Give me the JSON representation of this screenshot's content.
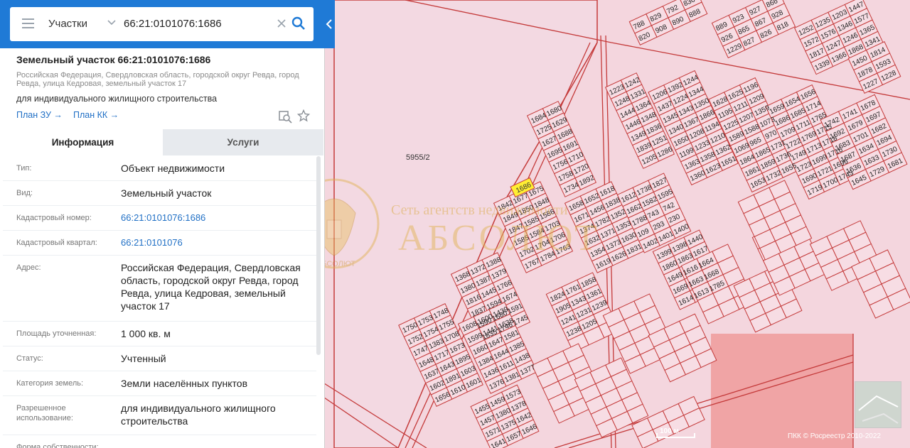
{
  "search": {
    "type_label": "Участки",
    "query": "66:21:0101076:1686"
  },
  "parcel": {
    "title": "Земельный участок 66:21:0101076:1686",
    "address_short": "Российская Федерация, Свердловская область, городской округ Ревда, город Ревда, улица Кедровая, земельный участок 17",
    "usage": "для индивидуального жилищного строительства",
    "plan_zu": "План ЗУ →",
    "plan_kk": "План КК →"
  },
  "tabs": {
    "info": "Информация",
    "services": "Услуги"
  },
  "fields": [
    {
      "label": "Тип:",
      "value": "Объект недвижимости",
      "link": false
    },
    {
      "label": "Вид:",
      "value": "Земельный участок",
      "link": false
    },
    {
      "label": "Кадастровый номер:",
      "value": "66:21:0101076:1686",
      "link": true
    },
    {
      "label": "Кадастровый квартал:",
      "value": "66:21:0101076",
      "link": true
    },
    {
      "label": "Адрес:",
      "value": "Российская Федерация, Свердловская область, городской округ Ревда, город Ревда, улица Кедровая, земельный участок 17",
      "link": false
    },
    {
      "label": "Площадь уточненная:",
      "value": "1 000 кв. м",
      "link": false
    },
    {
      "label": "Статус:",
      "value": "Учтенный",
      "link": false
    },
    {
      "label": "Категория земель:",
      "value": "Земли населённых пунктов",
      "link": false
    },
    {
      "label": "Разрешенное использование:",
      "value": "для индивидуального жилищного строительства",
      "link": false
    },
    {
      "label": "Форма собственности:",
      "value": "",
      "link": false
    }
  ],
  "map": {
    "big_parcel_label": "5955/2",
    "selected_parcel": "1686",
    "scale_label": "100 м",
    "copyright": "ПКК © Росреестр 2010-2022",
    "watermark_text": "Сеть агентств недвижимости",
    "watermark_brand": "АБСОЛЮТ",
    "watermark_emblem_text": "АБСОЛЮТ",
    "parcel_numbers": [
      "788",
      "829",
      "792",
      "830",
      "820",
      "908",
      "890",
      "888",
      "889",
      "923",
      "927",
      "866",
      "926",
      "865",
      "867",
      "928",
      "1229",
      "827",
      "826",
      "818",
      "1252",
      "1235",
      "1203",
      "1447",
      "1572",
      "1576",
      "1346",
      "1577",
      "1817",
      "1247",
      "1246",
      "1365",
      "1339",
      "1366",
      "1868",
      "1341",
      "1450",
      "1814",
      "1878",
      "1593",
      "1227",
      "1228",
      "1223",
      "1242",
      "1248",
      "1331",
      "1444",
      "1364",
      "1446",
      "1348",
      "1349",
      "1836",
      "1839",
      "1251",
      "1205",
      "1286",
      "1206",
      "1392",
      "1244",
      "1437",
      "1224",
      "1344",
      "1345",
      "1343",
      "1350",
      "1340",
      "1367",
      "1866",
      "1650",
      "1208",
      "1194",
      "1199",
      "1233",
      "1210",
      "1363",
      "1358",
      "1362",
      "1360",
      "1623",
      "1651",
      "1628",
      "1625",
      "1196",
      "1195",
      "1211",
      "1209",
      "1225",
      "1207",
      "1359",
      "1589",
      "1588",
      "1073",
      "1069",
      "965",
      "970",
      "1864",
      "1865",
      "1731",
      "1861",
      "1859",
      "1736",
      "1653",
      "1732",
      "1655",
      "1659",
      "1654",
      "1656",
      "1686",
      "1685",
      "1714",
      "1709",
      "1711",
      "1765",
      "1722",
      "1769",
      "1715",
      "1749",
      "1713",
      "1718",
      "1723",
      "1699",
      "1716",
      "1690",
      "1721",
      "1696",
      "1719",
      "1700",
      "1743",
      "1742",
      "1741",
      "1678",
      "1692",
      "1679",
      "1697",
      "1683",
      "1701",
      "1682",
      "1687",
      "1634",
      "1694",
      "1636",
      "1633",
      "1730",
      "1645",
      "1729",
      "1681",
      "1684",
      "1680",
      "1725",
      "1629",
      "1627",
      "1688",
      "1695",
      "1691",
      "1756",
      "1710",
      "1758",
      "1720",
      "1734",
      "1892",
      "1842",
      "1677",
      "1675",
      "1849",
      "1850",
      "1848",
      "1847",
      "1585",
      "1586",
      "1585",
      "1584",
      "1703",
      "1702",
      "1704",
      "1706",
      "1767",
      "1784",
      "1763",
      "1368",
      "1372",
      "1388",
      "1380",
      "1387",
      "1379",
      "1816",
      "1445",
      "1766",
      "1837",
      "1594",
      "1674",
      "1590",
      "1680",
      "1591",
      "1835",
      "1746",
      "1745",
      "1750",
      "1753",
      "1748",
      "1752",
      "1754",
      "1755",
      "1747",
      "1383",
      "1708",
      "1648",
      "1717",
      "1673",
      "1637",
      "1643",
      "1895",
      "1602",
      "1891",
      "1603",
      "1656",
      "1610",
      "1601",
      "1608",
      "1600",
      "1439",
      "1599",
      "1441",
      "1638",
      "1660",
      "1647",
      "1581",
      "1384",
      "1644",
      "1385",
      "1436",
      "1611",
      "1438",
      "1376",
      "1381",
      "1377",
      "1455",
      "1459",
      "1573",
      "1457",
      "1380",
      "1378",
      "1571",
      "1375",
      "1642",
      "1641",
      "1657",
      "1646",
      "1658",
      "1652",
      "1618",
      "1671",
      "1456",
      "1838",
      "1374",
      "1782",
      "1352",
      "1632",
      "1371",
      "1353",
      "1354",
      "1373",
      "1630",
      "1619",
      "1626",
      "1831",
      "1612",
      "1738",
      "1827",
      "1662",
      "1582",
      "1595",
      "1788",
      "743",
      "742",
      "109",
      "293",
      "230",
      "1402",
      "1401",
      "1400",
      "1399",
      "1398",
      "1440",
      "1860",
      "1863",
      "1617",
      "1649",
      "1616",
      "1664",
      "1669",
      "1663",
      "1668",
      "1614",
      "1613",
      "1785",
      "1824",
      "1761",
      "1858",
      "1905",
      "1343",
      "1361",
      "1241",
      "1231",
      "1239",
      "1238",
      "1205"
    ]
  }
}
